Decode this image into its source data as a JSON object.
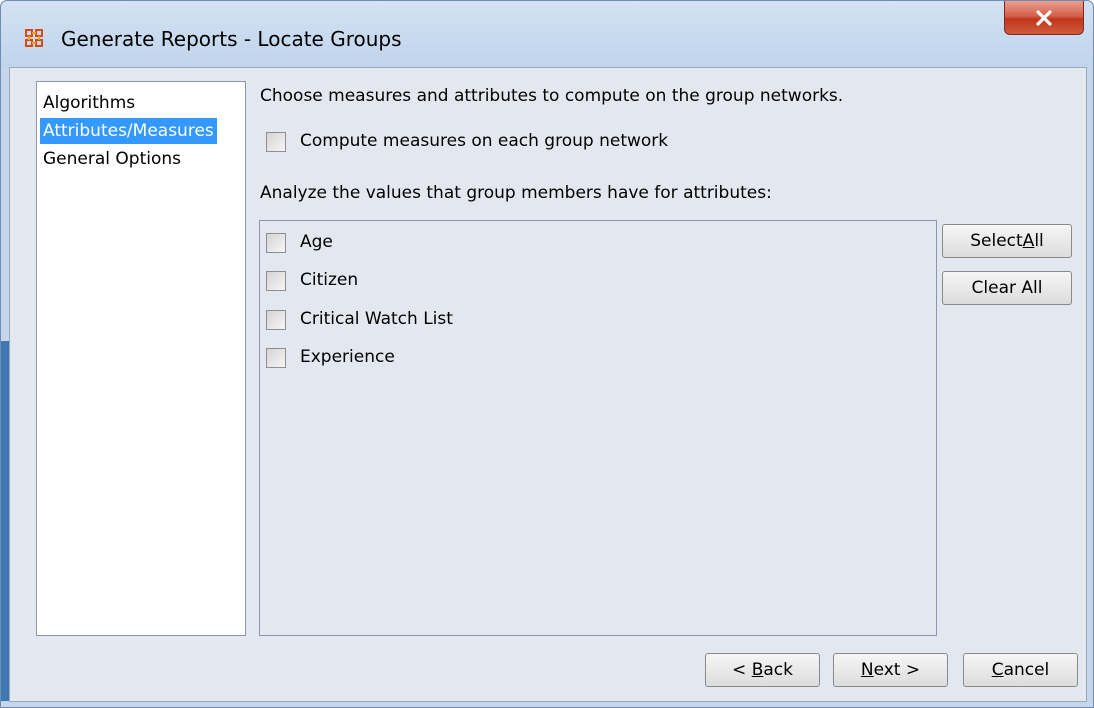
{
  "window": {
    "title": "Generate Reports - Locate Groups",
    "app_icon": "meta-network-icon",
    "close_icon": "close-x-icon"
  },
  "nav": {
    "items": [
      {
        "label": "Algorithms",
        "selected": false
      },
      {
        "label": "Attributes/Measures",
        "selected": true
      },
      {
        "label": "General Options",
        "selected": false
      }
    ]
  },
  "main": {
    "heading": "Choose measures and attributes to compute on the group networks.",
    "compute_measures": {
      "label": "Compute measures on each group network",
      "checked": false
    },
    "attributes_heading": "Analyze the values that group members have for attributes:",
    "attributes": [
      {
        "label": "Age",
        "checked": false
      },
      {
        "label": "Citizen",
        "checked": false
      },
      {
        "label": "Critical Watch List",
        "checked": false
      },
      {
        "label": "Experience",
        "checked": false
      }
    ]
  },
  "side_buttons": {
    "select_all": {
      "pre": "Select ",
      "mnemonic": "A",
      "post": "ll"
    },
    "clear_all": {
      "label": "Clear All"
    }
  },
  "footer": {
    "back": {
      "pre": "< ",
      "mnemonic": "B",
      "post": "ack"
    },
    "next": {
      "pre": "",
      "mnemonic": "N",
      "post": "ext >"
    },
    "cancel": {
      "pre": "",
      "mnemonic": "C",
      "post": "ancel"
    }
  },
  "colors": {
    "selection": "#3399ff",
    "frame": "#c5d6ea",
    "client_bg": "#e3e8f0",
    "close_button": "#c1361b"
  }
}
